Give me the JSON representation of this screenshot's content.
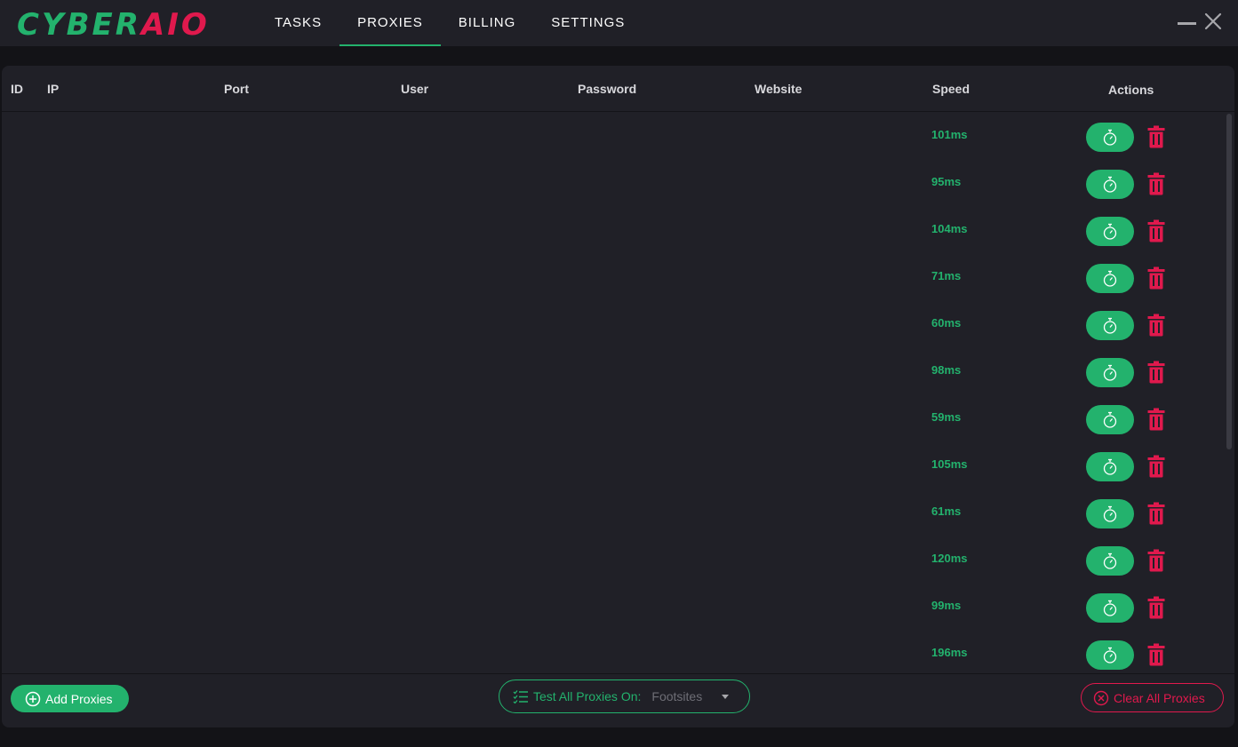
{
  "app": {
    "logo_part1": "CYBER",
    "logo_part2": "AIO"
  },
  "nav": {
    "tabs": [
      "TASKS",
      "PROXIES",
      "BILLING",
      "SETTINGS"
    ],
    "active": "PROXIES"
  },
  "table": {
    "columns": [
      "ID",
      "IP",
      "Port",
      "User",
      "Password",
      "Website",
      "Speed",
      "Actions"
    ],
    "rows": [
      {
        "speed": "101ms"
      },
      {
        "speed": "95ms"
      },
      {
        "speed": "104ms"
      },
      {
        "speed": "71ms"
      },
      {
        "speed": "60ms"
      },
      {
        "speed": "98ms"
      },
      {
        "speed": "59ms"
      },
      {
        "speed": "105ms"
      },
      {
        "speed": "61ms"
      },
      {
        "speed": "120ms"
      },
      {
        "speed": "99ms"
      },
      {
        "speed": "196ms"
      }
    ]
  },
  "footer": {
    "add_label": "Add Proxies",
    "test_all_label": "Test All Proxies On:",
    "test_all_value": "Footsites",
    "clear_label": "Clear All Proxies"
  },
  "colors": {
    "accent_green": "#23b26d",
    "danger_red": "#e0194d",
    "panel_bg": "#202027",
    "app_bg": "#131317"
  },
  "icons": {
    "row_test": "stopwatch-icon",
    "row_delete": "trash-icon",
    "add": "plus-circle-icon",
    "test_all": "checklist-icon",
    "clear": "x-circle-icon"
  }
}
